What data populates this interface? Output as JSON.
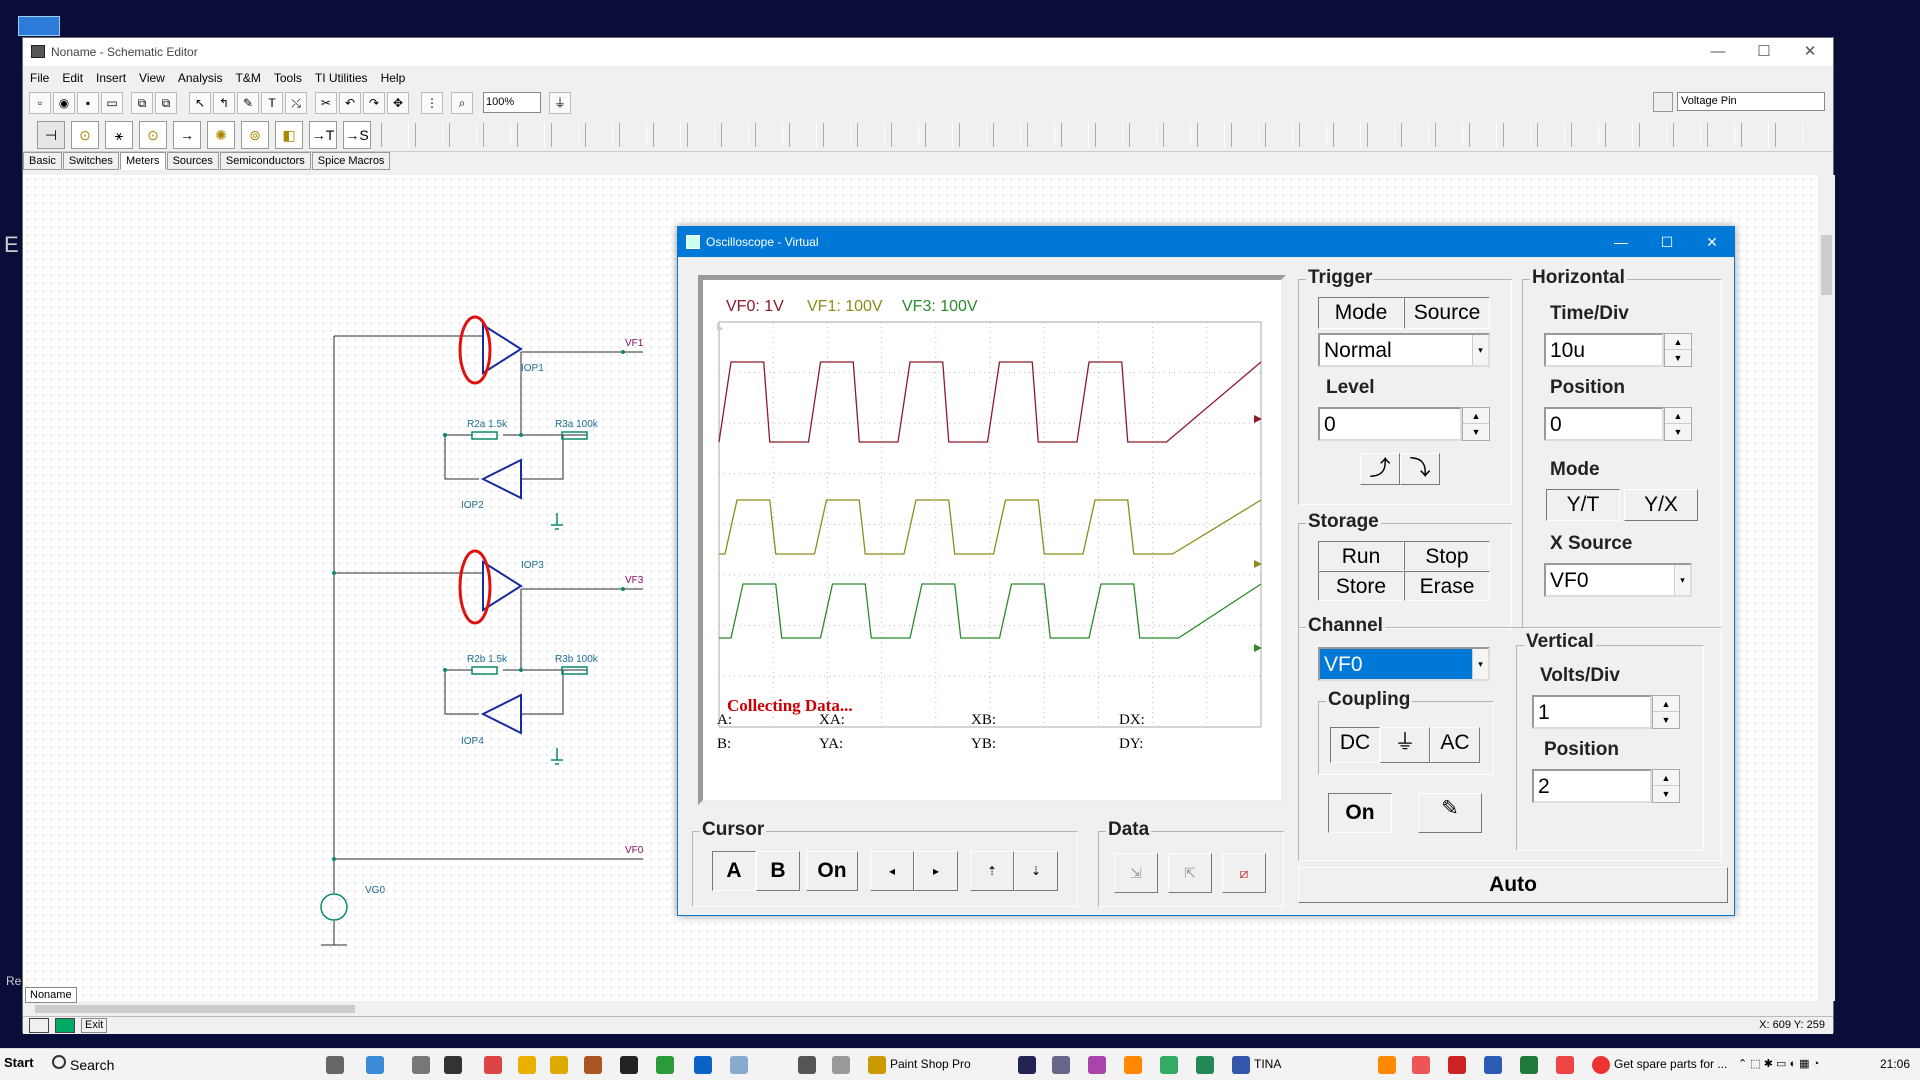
{
  "app": {
    "title": "Noname - Schematic Editor",
    "menus": [
      "File",
      "Edit",
      "Insert",
      "View",
      "Analysis",
      "T&M",
      "Tools",
      "TI Utilities",
      "Help"
    ],
    "zoom": "100%",
    "pin_select": "Voltage Pin",
    "component_tabs": [
      "Basic",
      "Switches",
      "Meters",
      "Sources",
      "Semiconductors",
      "Spice Macros"
    ],
    "active_tab": "Meters",
    "doc_tab": "Noname",
    "status_coords": "X: 609 Y: 259",
    "exit_label": "Exit"
  },
  "schematic": {
    "components": {
      "iop1": "IOP1",
      "iop2": "IOP2",
      "iop3": "IOP3",
      "iop4": "IOP4",
      "r2a": "R2a 1.5k",
      "r3a": "R3a 100k",
      "r2b": "R2b 1.5k",
      "r3b": "R3b 100k",
      "vg0": "VG0"
    },
    "nets": {
      "vf1": "VF1",
      "vf3": "VF3",
      "vf0": "VF0"
    }
  },
  "scope": {
    "title": "Oscilloscope - Virtual",
    "channels": [
      {
        "label": "VF0: 1V",
        "color": "#8b1a2a"
      },
      {
        "label": "VF1: 100V",
        "color": "#8d8c1a"
      },
      {
        "label": "VF3: 100V",
        "color": "#2b8a2b"
      }
    ],
    "status": "Collecting Data...",
    "cursor_readout": {
      "a": "A:",
      "xa": "XA:",
      "xb": "XB:",
      "dx": "DX:",
      "b": "B:",
      "ya": "YA:",
      "yb": "YB:",
      "dy": "DY:"
    },
    "trigger": {
      "title": "Trigger",
      "mode_label": "Mode",
      "source_label": "Source",
      "mode_value": "Normal",
      "level_label": "Level",
      "level_value": "0"
    },
    "horizontal": {
      "title": "Horizontal",
      "timediv_label": "Time/Div",
      "timediv_value": "10u",
      "position_label": "Position",
      "position_value": "0",
      "mode_label": "Mode",
      "yt": "Y/T",
      "yx": "Y/X",
      "xsource_label": "X Source",
      "xsource_value": "VF0"
    },
    "storage": {
      "title": "Storage",
      "run": "Run",
      "stop": "Stop",
      "store": "Store",
      "erase": "Erase"
    },
    "channel": {
      "title": "Channel",
      "value": "VF0",
      "coupling_label": "Coupling",
      "dc": "DC",
      "gnd": "⏚",
      "ac": "AC",
      "on": "On"
    },
    "vertical": {
      "title": "Vertical",
      "voltsdiv_label": "Volts/Div",
      "voltsdiv_value": "1",
      "position_label": "Position",
      "position_value": "2"
    },
    "cursor": {
      "title": "Cursor",
      "a": "A",
      "b": "B",
      "on": "On"
    },
    "data": {
      "title": "Data"
    },
    "auto": "Auto"
  },
  "taskbar": {
    "start": "Start",
    "search": "Search",
    "items": [
      "Paint Shop Pro",
      "TINA",
      "Get spare parts for ..."
    ],
    "clock": "21:06"
  }
}
